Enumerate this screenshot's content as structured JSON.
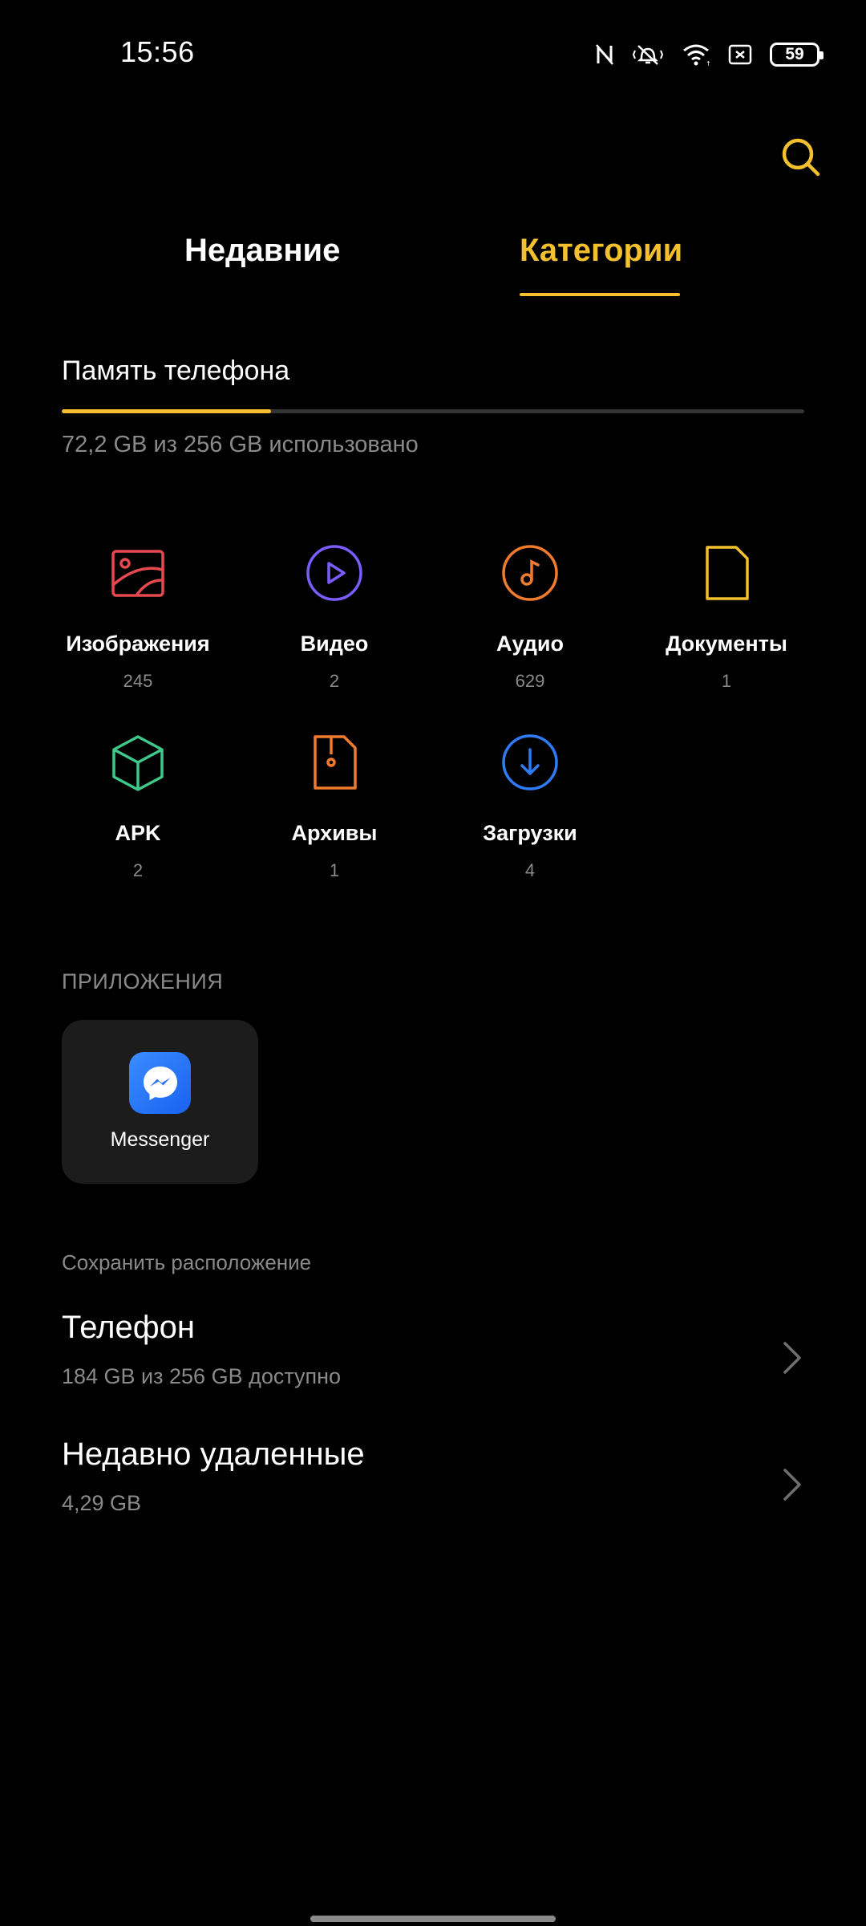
{
  "status_bar": {
    "time": "15:56",
    "battery_level": "59",
    "icons": [
      "nfc-icon",
      "vibrate-icon",
      "wifi-icon",
      "screenshot-icon",
      "battery-icon"
    ]
  },
  "toolbar": {
    "search_icon": "search-icon",
    "accent_color": "#f5c02e"
  },
  "tabs": [
    {
      "label": "Недавние",
      "active": false
    },
    {
      "label": "Категории",
      "active": true
    }
  ],
  "storage": {
    "title": "Память телефона",
    "used_text": "72,2 GB из 256 GB использовано",
    "used_fraction": 0.282
  },
  "categories": [
    {
      "name": "Изображения",
      "count": "245",
      "icon": "image-icon",
      "color": "#e5484d"
    },
    {
      "name": "Видео",
      "count": "2",
      "icon": "video-icon",
      "color": "#7b5cff"
    },
    {
      "name": "Аудио",
      "count": "629",
      "icon": "audio-icon",
      "color": "#f07b2d"
    },
    {
      "name": "Документы",
      "count": "1",
      "icon": "document-icon",
      "color": "#f5c02e"
    },
    {
      "name": "APK",
      "count": "2",
      "icon": "apk-icon",
      "color": "#3ec98a"
    },
    {
      "name": "Архивы",
      "count": "1",
      "icon": "archive-icon",
      "color": "#f07b2d"
    },
    {
      "name": "Загрузки",
      "count": "4",
      "icon": "download-icon",
      "color": "#2f7bf5"
    }
  ],
  "apps": {
    "header": "ПРИЛОЖЕНИЯ",
    "items": [
      {
        "label": "Messenger",
        "icon": "messenger-icon"
      }
    ]
  },
  "save_location": {
    "header": "Сохранить расположение",
    "items": [
      {
        "title": "Телефон",
        "subtitle": "184 GB из 256 GB доступно"
      },
      {
        "title": "Недавно удаленные",
        "subtitle": "4,29 GB"
      }
    ]
  }
}
